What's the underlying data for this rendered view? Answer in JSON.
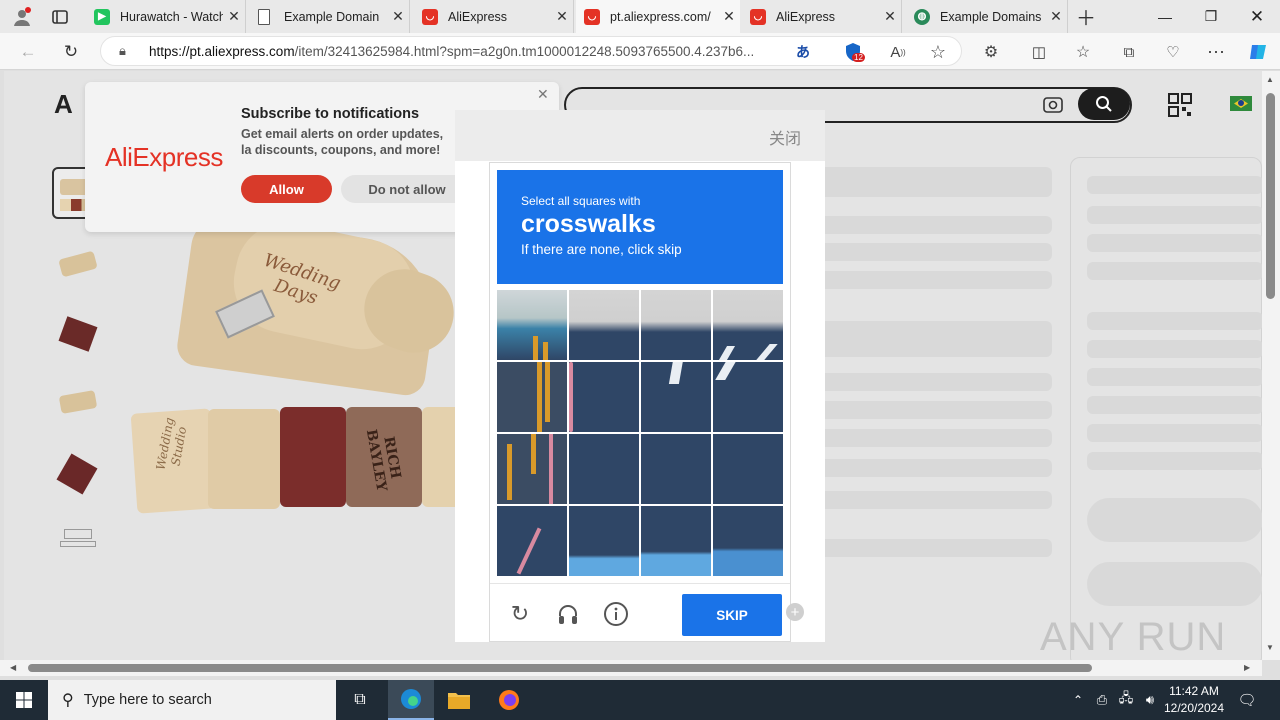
{
  "browser": {
    "tabs": [
      {
        "label": "Hurawatch - Watch",
        "icon": "play-icon",
        "color": "#22c55e"
      },
      {
        "label": "Example Domain",
        "icon": "page-icon",
        "color": "#ffffff"
      },
      {
        "label": "AliExpress",
        "icon": "aliexpress-icon",
        "color": "#e43225"
      },
      {
        "label": "pt.aliexpress.com/",
        "icon": "aliexpress-icon",
        "color": "#e43225"
      },
      {
        "label": "AliExpress",
        "icon": "aliexpress-icon",
        "color": "#e43225"
      },
      {
        "label": "Example Domains",
        "icon": "globe-icon",
        "color": "#2a8a5a"
      }
    ],
    "url_host": "https://pt.aliexpress.com",
    "url_path": "/item/32413625984.html?spm=a2g0n.tm1000012248.5093765500.4.237b6...",
    "extension_badge": "12"
  },
  "notification": {
    "brand": "AliExpress",
    "title": "Subscribe to notifications",
    "body": "Get email alerts on order updates, la discounts, coupons, and more!",
    "allow": "Allow",
    "deny": "Do not allow"
  },
  "captcha": {
    "close_label": "关闭",
    "instruction_small": "Select all squares with",
    "target": "crosswalks",
    "instruction_hint": "If there are none, click skip",
    "skip_label": "SKIP"
  },
  "product": {
    "engraving_1": "Wedding Days",
    "engraving_2": "Wedding Studio",
    "engraving_3": "RICH BAYLEY",
    "engraving_4": "Wedding Studio"
  },
  "watermark": "ANY RUN",
  "taskbar": {
    "search_placeholder": "Type here to search",
    "time": "11:42 AM",
    "date": "12/20/2024"
  },
  "colors": {
    "accent": "#1a73e8",
    "aliexpress": "#e43225"
  }
}
